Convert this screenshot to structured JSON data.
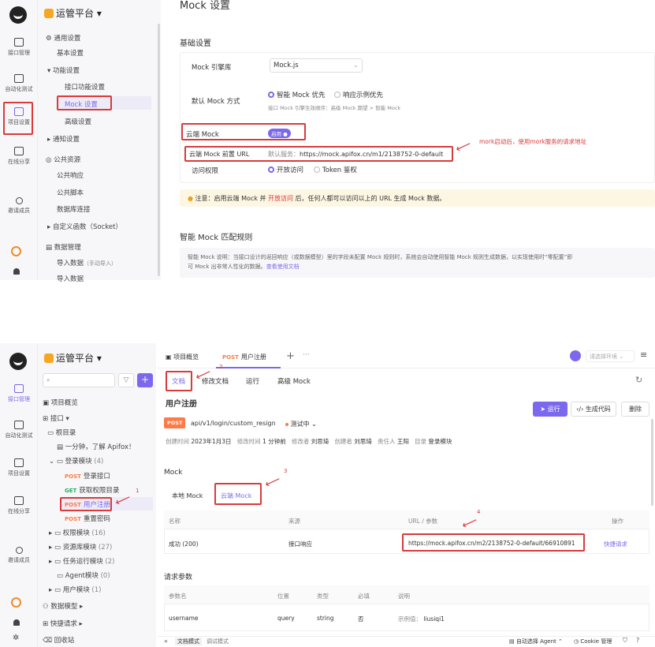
{
  "colors": {
    "accent": "#7b68ee",
    "annotation_red": "#d93a3a",
    "post": "#ff7a45",
    "get": "#27ae60",
    "warning_bg": "#fdf6e3"
  },
  "top": {
    "brand": "运管平台",
    "rail": {
      "api": "接口管理",
      "autotest": "自动化测试",
      "project": "项目设置",
      "share": "在线分享",
      "invite": "邀请成员"
    },
    "nav": {
      "general": "通用设置",
      "basic": "基本设置",
      "features": "功能设置",
      "api_features": "接口功能设置",
      "mock_settings": "Mock 设置",
      "advanced": "高级设置",
      "notify": "通知设置",
      "public": "公共资源",
      "public_response": "公共响应",
      "public_script": "公共脚本",
      "db_conn": "数据库连接",
      "custom_func": "自定义函数（Socket）",
      "data_mgmt": "数据管理",
      "import": "导入数据",
      "import_note": "（手动导入）",
      "import2": "导入数据"
    },
    "page_title": "Mock 设置",
    "basic_title": "基础设置",
    "engine_label": "Mock 引擎库",
    "engine_value": "Mock.js",
    "method_label": "默认 Mock 方式",
    "smart_first": "智能 Mock 优先",
    "example_first": "响应示例优先",
    "priority_note": "接口 Mock 引擎生效顺序：高级 Mock 期望 > 智能 Mock",
    "cloud_label": "云端 Mock",
    "cloud_toggle": "启用",
    "cloud_url_label": "云端 Mock 前置 URL",
    "cloud_url_prefix": "默认服务：",
    "cloud_url": "https://mock.apifox.cn/m1/2138752-0-default",
    "annotation": "mork启动后，使用mork服务的请求地址",
    "access_label": "访问权限",
    "open_access": "开放访问",
    "token_auth": "Token 鉴权",
    "notice_a": "注意：启用云端 Mock 并",
    "notice_link": "开放访问",
    "notice_b": "后，任何人都可以访问以上的 URL 生成 Mock 数据。",
    "smart_title": "智能 Mock 匹配规则",
    "smart_desc_1": "智能 Mock 说明：当接口设计的返回响应（或数据模型）里的字段未配置 Mock 规则时，系统会自动使用智能 Mock 规则生成数据，以实现使用时“零配置”即",
    "smart_desc_2": "可 Mock 出非常人性化的数据。",
    "smart_link": "查看使用文档"
  },
  "bottom": {
    "brand": "运管平台",
    "rail": {
      "api": "接口管理",
      "autotest": "自动化测试",
      "project": "项目设置",
      "share": "在线分享",
      "invite": "邀请成员"
    },
    "tree": {
      "overview": "项目概览",
      "apis": "接口",
      "root": "根目录",
      "intro": "一分钟，了解 Apifox！",
      "login_module": "登录模块",
      "login_count": "(4)",
      "items": [
        {
          "method": "POST",
          "name": "登录接口"
        },
        {
          "method": "GET",
          "name": "获取权限目录"
        },
        {
          "method": "POST",
          "name": "用户注册"
        },
        {
          "method": "POST",
          "name": "重置密码"
        }
      ],
      "folders": [
        {
          "name": "权限模块",
          "count": "(16)"
        },
        {
          "name": "资源库模块",
          "count": "(27)"
        },
        {
          "name": "任务运行模块",
          "count": "(2)"
        },
        {
          "name": "Agent模块",
          "count": "(0)"
        },
        {
          "name": "用户模块",
          "count": "(1)"
        }
      ],
      "data_model": "数据模型",
      "quick_request": "快捷请求",
      "recycle": "回收站"
    },
    "tabs": {
      "overview": "项目概览",
      "current_method": "POST",
      "current": "用户注册",
      "env": "请选择环境"
    },
    "subtabs": {
      "doc": "文档",
      "edit": "修改文档",
      "run": "运行",
      "adv": "高级 Mock"
    },
    "api": {
      "title": "用户注册",
      "method": "POST",
      "path": "api/v1/login/custom_resign",
      "status": "测试中",
      "run_btn": "运行",
      "gen_btn": "生成代码",
      "del_btn": "删除",
      "created_label": "创建时间",
      "created": "2023年1月3日",
      "modified_label": "修改时间",
      "modified": "1 分钟前",
      "modifier_label": "修改者",
      "modifier": "刘思琦",
      "creator_label": "创建者",
      "creator": "刘思琦",
      "owner_label": "责任人",
      "owner": "王阳",
      "dir_label": "目录",
      "dir": "登录模块"
    },
    "mock": {
      "title": "Mock",
      "local": "本地 Mock",
      "cloud": "云端 Mock",
      "col_name": "名称",
      "col_source": "来源",
      "col_url": "URL / 参数",
      "col_op": "操作",
      "row_name": "成功 (200)",
      "row_source": "接口响应",
      "row_url": "https://mock.apifox.cn/m2/2138752-0-default/66910891",
      "row_op": "快捷请求"
    },
    "params": {
      "title": "请求参数",
      "headers": [
        "参数名",
        "位置",
        "类型",
        "必填",
        "说明"
      ],
      "row": {
        "name": "username",
        "loc": "query",
        "type": "string",
        "required": "否",
        "example": "示例值：",
        "example_val": "liusiqi1"
      }
    },
    "footer": {
      "doc_mode": "文档模式",
      "debug_mode": "调试模式",
      "agent": "自动选择 Agent",
      "cookie": "Cookie 管理"
    },
    "markers": {
      "m1": "1",
      "m2": "2",
      "m3": "3",
      "m4": "4"
    }
  }
}
